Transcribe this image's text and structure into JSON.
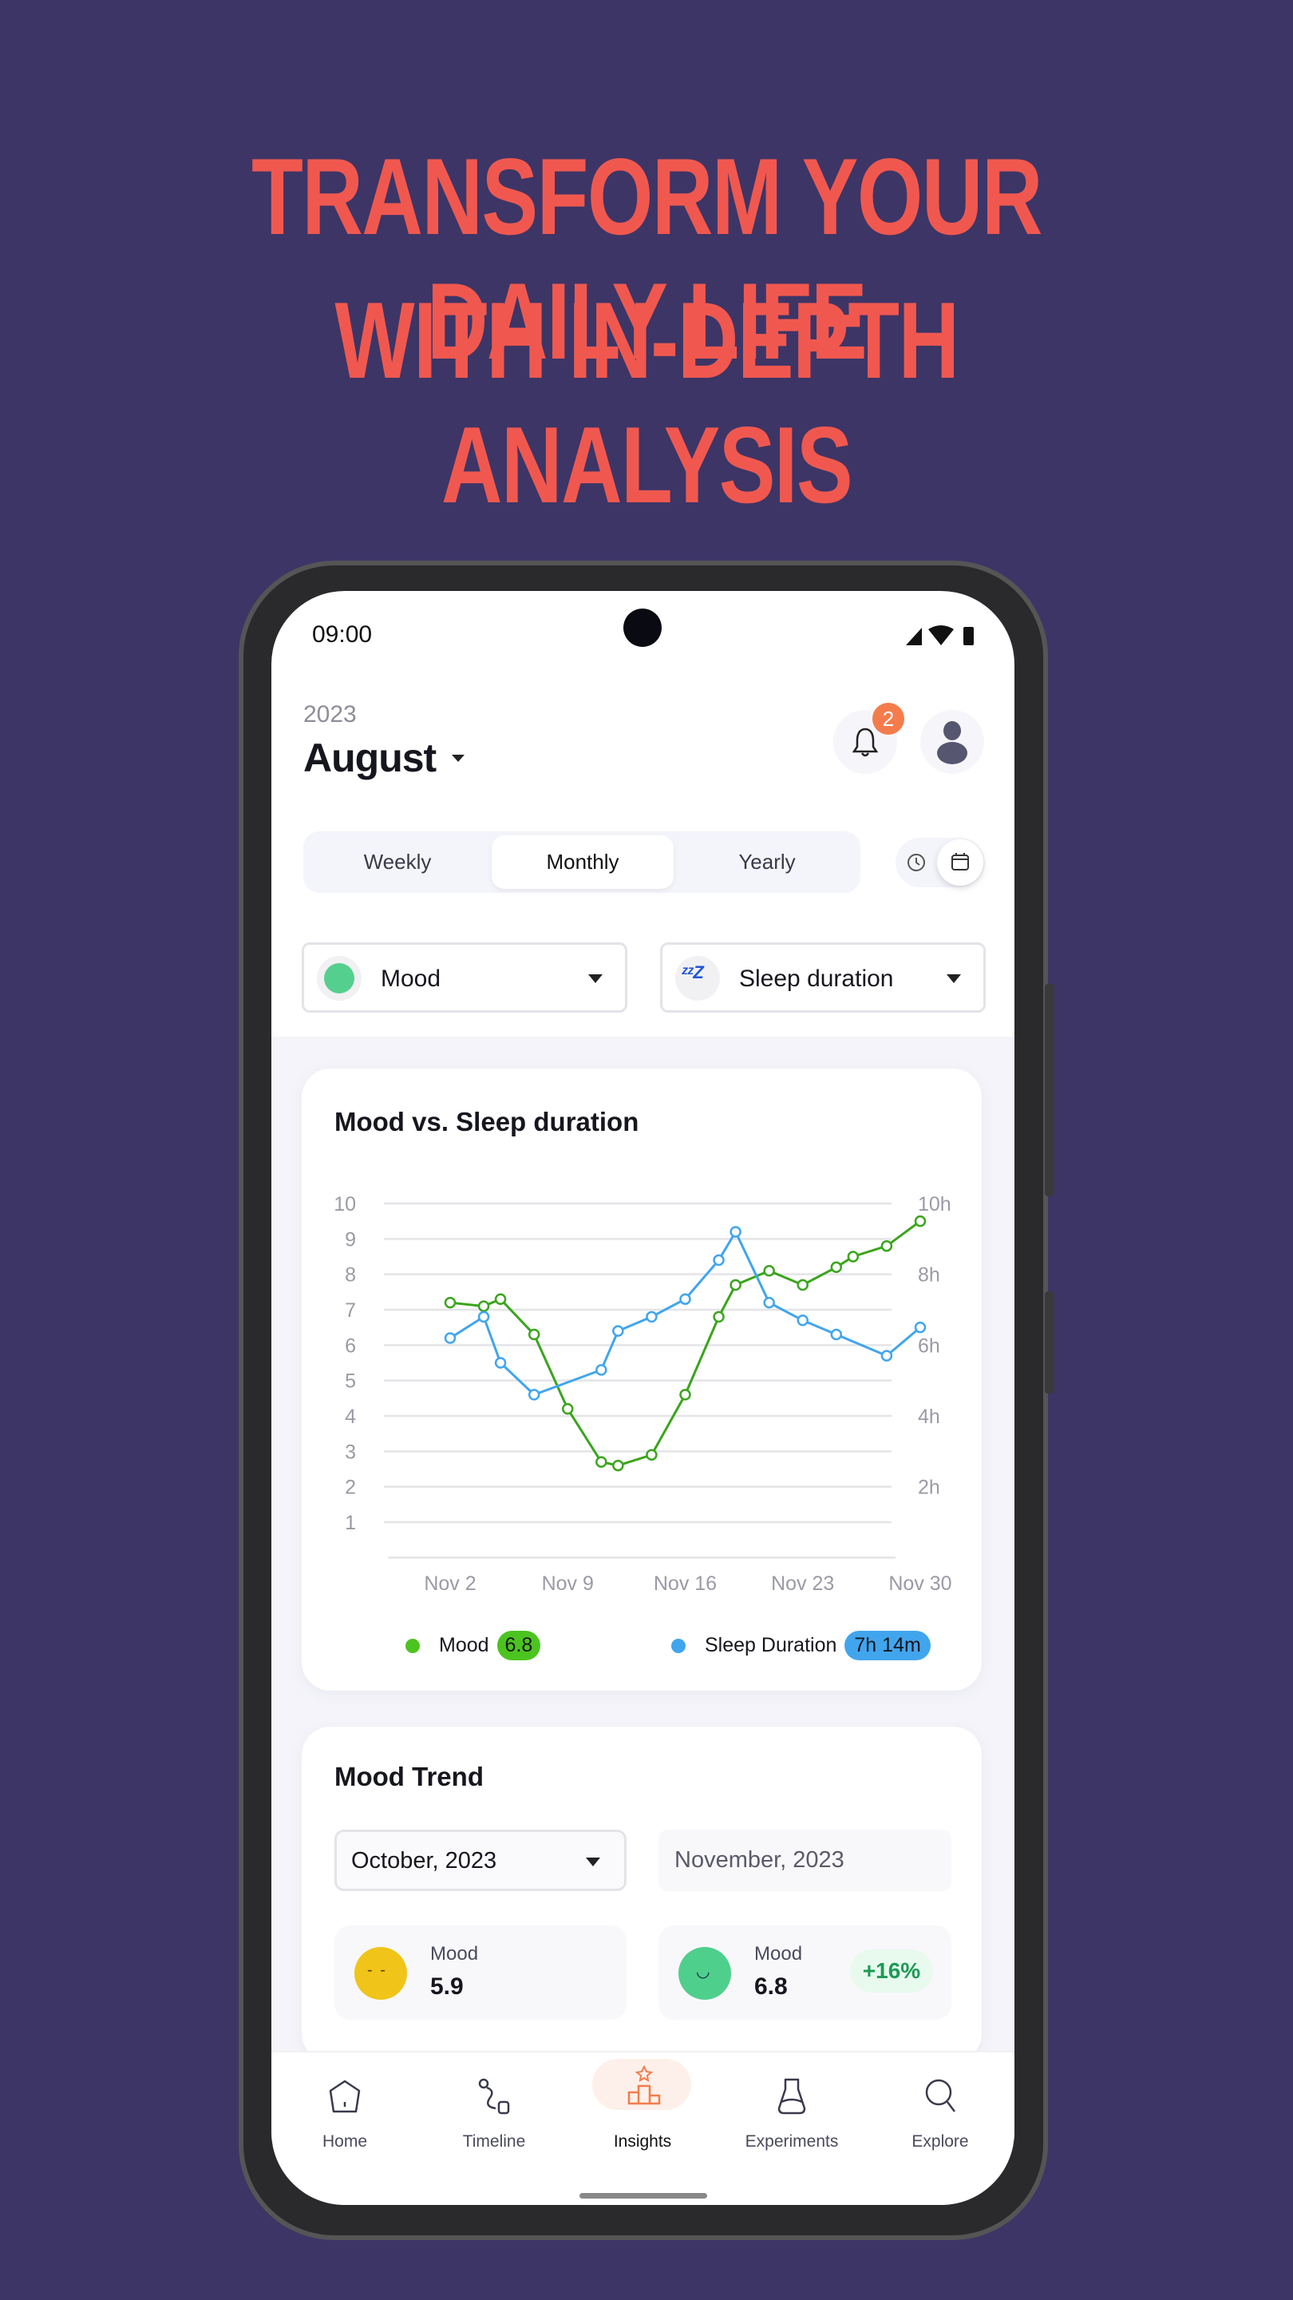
{
  "headline": {
    "line1": "TRANSFORM YOUR DAILY LIFE",
    "line2": "WITH IN-DEPTH ANALYSIS"
  },
  "colors": {
    "background": "#3d3566",
    "headline": "#f0584f",
    "mood": "#3aa51c",
    "sleep": "#41a5ee",
    "accent": "#f47c4c"
  },
  "status_bar": {
    "time": "09:00",
    "icons": [
      "signal-icon",
      "wifi-icon",
      "battery-icon"
    ]
  },
  "header": {
    "year": "2023",
    "month": "August",
    "notification_count": "2"
  },
  "period_tabs": [
    {
      "label": "Weekly",
      "active": false
    },
    {
      "label": "Monthly",
      "active": true
    },
    {
      "label": "Yearly",
      "active": false
    }
  ],
  "view_toggle": {
    "options": [
      "clock-icon",
      "calendar-icon"
    ],
    "active": "calendar-icon"
  },
  "metric_selects": [
    {
      "label": "Mood",
      "icon": "mood-face-icon"
    },
    {
      "label": "Sleep duration",
      "icon": "zzz-sleep-icon"
    }
  ],
  "chart_card": {
    "title": "Mood vs. Sleep duration"
  },
  "chart_data": {
    "type": "line",
    "title": "Mood vs. Sleep duration",
    "x_ticks": [
      "Nov 2",
      "Nov 9",
      "Nov 16",
      "Nov 23",
      "Nov 30"
    ],
    "y_left_ticks": [
      "10",
      "9",
      "8",
      "7",
      "6",
      "5",
      "4",
      "3",
      "2",
      "1"
    ],
    "y_right_ticks": [
      "10h",
      "8h",
      "6h",
      "4h",
      "2h"
    ],
    "ylim": [
      0,
      10
    ],
    "grid": true,
    "legend_position": "bottom",
    "series": [
      {
        "name": "Mood",
        "axis": "left",
        "color": "#3aa51c",
        "x": [
          "Nov 2",
          "Nov 4",
          "Nov 5",
          "Nov 7",
          "Nov 9",
          "Nov 11",
          "Nov 12",
          "Nov 14",
          "Nov 16",
          "Nov 18",
          "Nov 19",
          "Nov 21",
          "Nov 23",
          "Nov 25",
          "Nov 26",
          "Nov 28",
          "Nov 30"
        ],
        "y": [
          7.2,
          7.1,
          7.3,
          6.3,
          4.2,
          2.7,
          2.6,
          2.9,
          4.6,
          6.8,
          7.7,
          8.1,
          7.7,
          8.2,
          8.5,
          8.8,
          9.5
        ]
      },
      {
        "name": "Sleep Duration",
        "axis": "right",
        "color": "#41a5ee",
        "x": [
          "Nov 2",
          "Nov 4",
          "Nov 5",
          "Nov 7",
          "Nov 11",
          "Nov 12",
          "Nov 14",
          "Nov 16",
          "Nov 18",
          "Nov 19",
          "Nov 21",
          "Nov 23",
          "Nov 25",
          "Nov 28",
          "Nov 30"
        ],
        "y": [
          6.2,
          6.8,
          5.5,
          4.6,
          5.3,
          6.4,
          6.8,
          7.3,
          8.4,
          9.2,
          7.2,
          6.7,
          6.3,
          5.7,
          6.5
        ]
      }
    ],
    "legend": [
      {
        "label": "Mood",
        "value": "6.8"
      },
      {
        "label": "Sleep Duration",
        "value": "7h 14m"
      }
    ]
  },
  "mood_trend": {
    "title": "Mood Trend",
    "period_a": "October, 2023",
    "period_b": "November, 2023",
    "stat_a": {
      "label": "Mood",
      "value": "5.9",
      "icon": "neutral-face-icon"
    },
    "stat_b": {
      "label": "Mood",
      "value": "6.8",
      "change": "+16%",
      "icon": "smile-face-icon"
    }
  },
  "nav": [
    {
      "label": "Home",
      "icon": "home-icon",
      "active": false
    },
    {
      "label": "Timeline",
      "icon": "timeline-icon",
      "active": false
    },
    {
      "label": "Insights",
      "icon": "podium-icon",
      "active": true
    },
    {
      "label": "Experiments",
      "icon": "flask-icon",
      "active": false
    },
    {
      "label": "Explore",
      "icon": "search-icon",
      "active": false
    }
  ]
}
